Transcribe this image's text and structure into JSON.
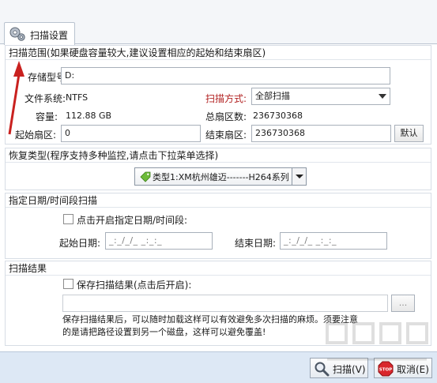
{
  "tab": {
    "label": "扫描设置",
    "icon": "gear-icon"
  },
  "scan_range": {
    "title": "扫描范围(如果硬盘容量较大,建议设置相应的起始和结束扇区)",
    "storage_model_label": "存储型号:",
    "storage_model_value": "D:",
    "filesystem_label": "文件系统:",
    "filesystem_value": "NTFS",
    "scan_method_label": "扫描方式:",
    "scan_method_value": "全部扫描",
    "capacity_label": "容量:",
    "capacity_value": "112.88 GB",
    "total_sectors_label": "总扇区数:",
    "total_sectors_value": "236730368",
    "start_sector_label": "起始扇区:",
    "start_sector_value": "0",
    "end_sector_label": "结束扇区:",
    "end_sector_value": "236730368",
    "default_button": "默认"
  },
  "recovery_type": {
    "title": "恢复类型(程序支持多种监控,请点击下拉菜单选择)",
    "selected": "类型1:XM杭州雄迈-------H264系列",
    "icon": "tag-icon"
  },
  "date_range": {
    "title": "指定日期/时间段扫描",
    "checkbox_label": "点击开启指定日期/时间段:",
    "start_label": "起始日期:",
    "start_value": "_:_/_/_ _:_:_",
    "end_label": "结束日期:",
    "end_value": "_:_/_/_ _:_:_"
  },
  "scan_result": {
    "title": "扫描结果",
    "checkbox_label": "保存扫描结果(点击后开启):",
    "path_value": "",
    "browse_button": "...",
    "note_line1": "保存扫描结果后，可以随时加载这样可以有效避免多次扫描的麻烦。须要注意",
    "note_line2": "的是请把路径设置到另一个磁盘，这样可以避免覆盖!"
  },
  "footer": {
    "scan_button": "扫描(V)",
    "cancel_button": "取消(E)",
    "stop_icon_text": "STOP"
  },
  "colors": {
    "accent_red": "#d9262c",
    "label_red": "#b22222",
    "footer_bg": "#dde8f5"
  }
}
